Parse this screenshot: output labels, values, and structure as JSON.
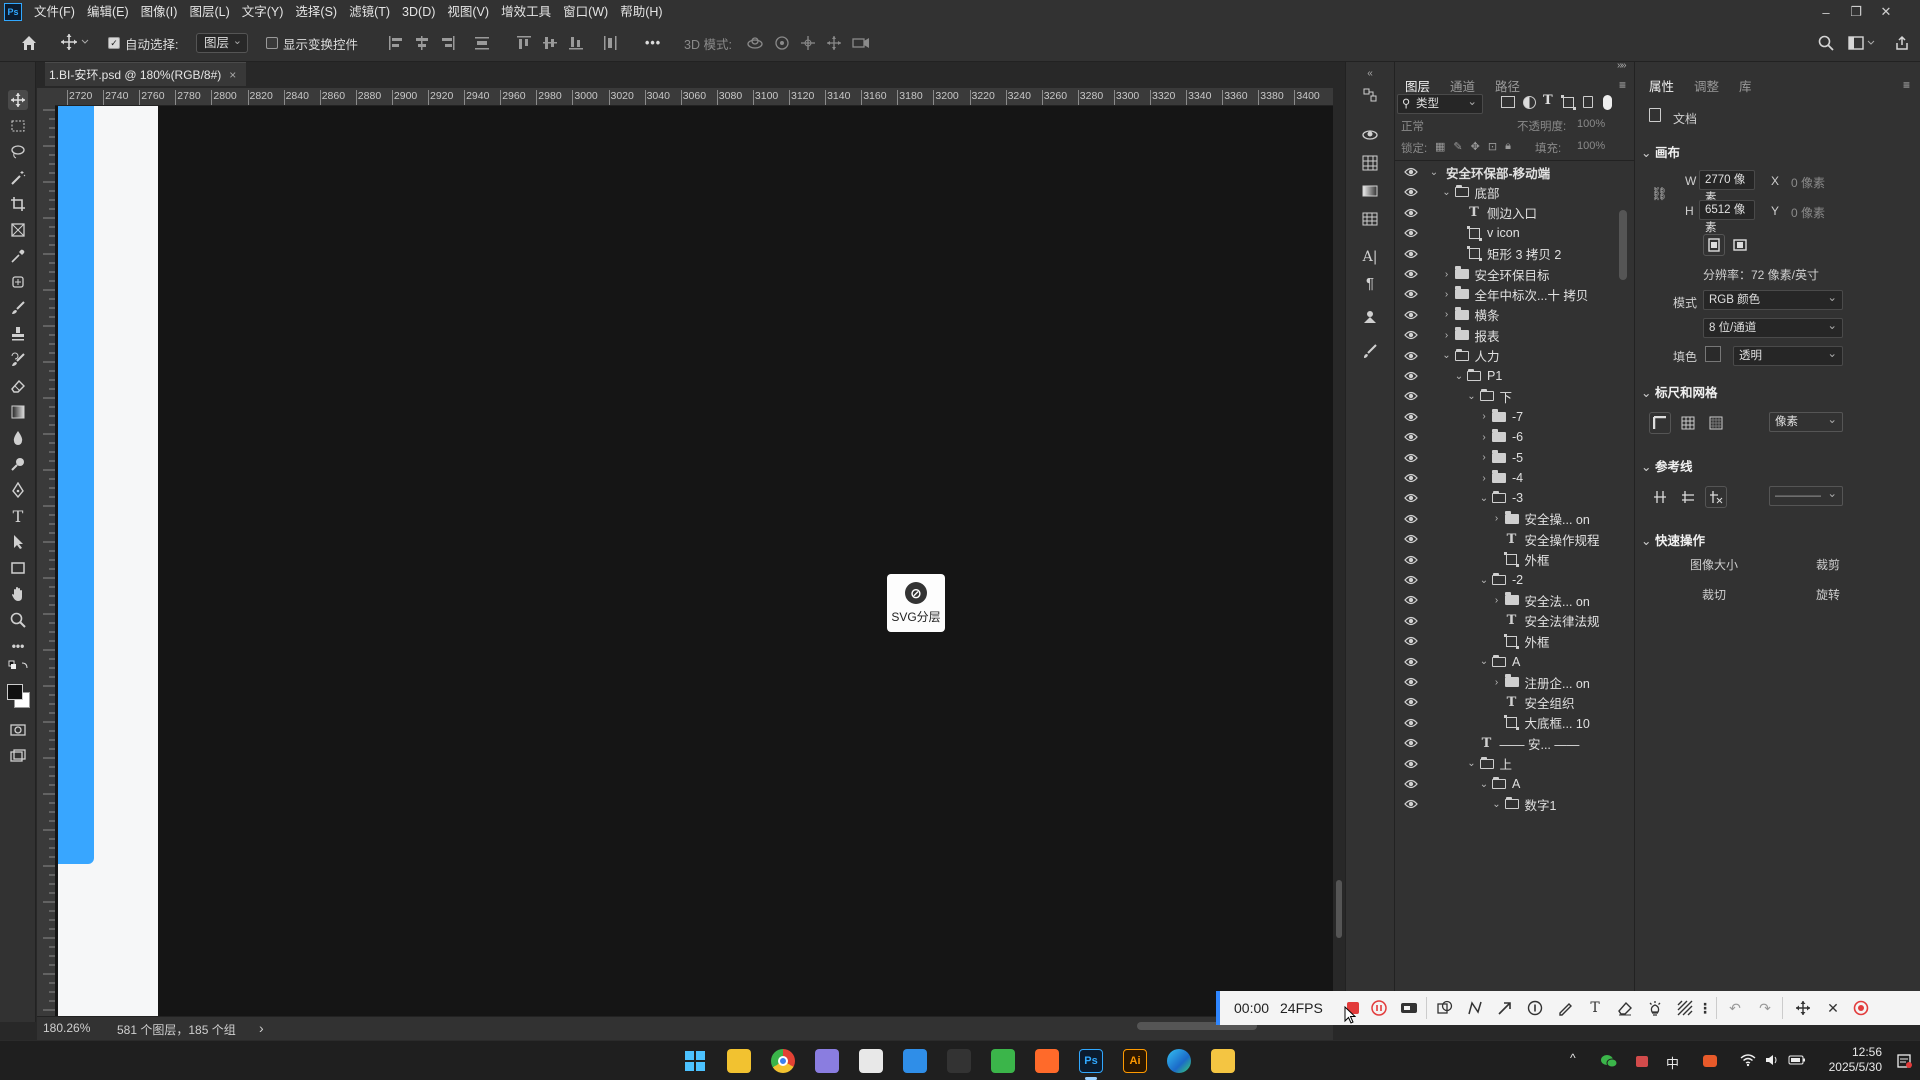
{
  "menubar": {
    "logo": "Ps",
    "items": [
      "文件(F)",
      "编辑(E)",
      "图像(I)",
      "图层(L)",
      "文字(Y)",
      "选择(S)",
      "滤镜(T)",
      "3D(D)",
      "视图(V)",
      "增效工具",
      "窗口(W)",
      "帮助(H)"
    ]
  },
  "options": {
    "auto_select_label": "自动选择:",
    "auto_select_value": "图层",
    "show_transform_label": "显示变换控件",
    "mode3d_label": "3D 模式:",
    "more": "•••"
  },
  "document": {
    "tab_title": "1.BI-安环.psd @ 180%(RGB/8#)",
    "tab_close": "×"
  },
  "ruler": {
    "h_ticks": [
      "2720",
      "2740",
      "2760",
      "2780",
      "2800",
      "2820",
      "2840",
      "2860",
      "2880",
      "2900",
      "2920",
      "2940",
      "2960",
      "2980",
      "3000",
      "3020",
      "3040",
      "3060",
      "3080",
      "3100",
      "3120",
      "3140",
      "3160",
      "3180",
      "3200",
      "3220",
      "3240",
      "3260",
      "3280",
      "3300",
      "3320",
      "3340",
      "3360",
      "3380",
      "3400"
    ]
  },
  "canvas": {
    "badge_label": "SVG分层"
  },
  "status": {
    "zoom": "180.26%",
    "info": "581 个图层，185 个组",
    "arrow": "›"
  },
  "layers_panel": {
    "tabs": [
      "图层",
      "通道",
      "路径"
    ],
    "filter_label": "类型",
    "blend_mode": "正常",
    "opacity_label": "不透明度:",
    "opacity_value": "100%",
    "lock_label": "锁定:",
    "fill_label": "填充:",
    "fill_value": "100%",
    "rows": [
      {
        "indent": 0,
        "arrow": "⌄",
        "icon": "none",
        "label": "安全环保部-移动端",
        "bold": true
      },
      {
        "indent": 1,
        "arrow": "⌄",
        "icon": "folder-open",
        "label": "底部"
      },
      {
        "indent": 2,
        "arrow": "",
        "icon": "text",
        "label": "侧边入口"
      },
      {
        "indent": 2,
        "arrow": "",
        "icon": "shape",
        "label": "v icon"
      },
      {
        "indent": 2,
        "arrow": "",
        "icon": "shape",
        "label": "矩形 3 拷贝 2"
      },
      {
        "indent": 1,
        "arrow": "›",
        "icon": "folder",
        "label": "安全环保目标"
      },
      {
        "indent": 1,
        "arrow": "›",
        "icon": "folder",
        "label": "全年中标次...十 拷贝"
      },
      {
        "indent": 1,
        "arrow": "›",
        "icon": "folder",
        "label": "横条"
      },
      {
        "indent": 1,
        "arrow": "›",
        "icon": "folder",
        "label": "报表"
      },
      {
        "indent": 1,
        "arrow": "⌄",
        "icon": "folder-open",
        "label": "人力"
      },
      {
        "indent": 2,
        "arrow": "⌄",
        "icon": "folder-open",
        "label": "P1"
      },
      {
        "indent": 3,
        "arrow": "⌄",
        "icon": "folder-open",
        "label": "下"
      },
      {
        "indent": 4,
        "arrow": "›",
        "icon": "folder",
        "label": "-7"
      },
      {
        "indent": 4,
        "arrow": "›",
        "icon": "folder",
        "label": "-6"
      },
      {
        "indent": 4,
        "arrow": "›",
        "icon": "folder",
        "label": "-5"
      },
      {
        "indent": 4,
        "arrow": "›",
        "icon": "folder",
        "label": "-4"
      },
      {
        "indent": 4,
        "arrow": "⌄",
        "icon": "folder-open",
        "label": "-3"
      },
      {
        "indent": 5,
        "arrow": "›",
        "icon": "folder",
        "label": "安全操... on"
      },
      {
        "indent": 5,
        "arrow": "",
        "icon": "text",
        "label": "安全操作规程"
      },
      {
        "indent": 5,
        "arrow": "",
        "icon": "shape",
        "label": "外框"
      },
      {
        "indent": 4,
        "arrow": "⌄",
        "icon": "folder-open",
        "label": "-2"
      },
      {
        "indent": 5,
        "arrow": "›",
        "icon": "folder",
        "label": "安全法... on"
      },
      {
        "indent": 5,
        "arrow": "",
        "icon": "text",
        "label": "安全法律法规"
      },
      {
        "indent": 5,
        "arrow": "",
        "icon": "shape",
        "label": "外框"
      },
      {
        "indent": 4,
        "arrow": "⌄",
        "icon": "folder-open",
        "label": "A"
      },
      {
        "indent": 5,
        "arrow": "›",
        "icon": "folder",
        "label": "注册企... on"
      },
      {
        "indent": 5,
        "arrow": "",
        "icon": "text",
        "label": "安全组织"
      },
      {
        "indent": 5,
        "arrow": "",
        "icon": "shape",
        "label": "大底框... 10"
      },
      {
        "indent": 3,
        "arrow": "",
        "icon": "text",
        "label": "—— 安... ——"
      },
      {
        "indent": 3,
        "arrow": "⌄",
        "icon": "folder-open",
        "label": "上"
      },
      {
        "indent": 4,
        "arrow": "⌄",
        "icon": "folder-open",
        "label": "A"
      },
      {
        "indent": 5,
        "arrow": "⌄",
        "icon": "folder-open",
        "label": "数字1"
      }
    ]
  },
  "properties_panel": {
    "tabs": [
      "属性",
      "调整",
      "库"
    ],
    "doc_label": "文档",
    "canvas_section": "画布",
    "w_label": "W",
    "w_value": "2770 像素",
    "h_label": "H",
    "h_value": "6512 像素",
    "x_label": "X",
    "x_value": "0 像素",
    "y_label": "Y",
    "y_value": "0 像素",
    "resolution": "分辨率：72 像素/英寸",
    "mode_label": "模式",
    "mode_value": "RGB 颜色",
    "depth_value": "8 位/通道",
    "fill_label": "填色",
    "fill_value": "透明",
    "rulers_section": "标尺和网格",
    "ruler_unit": "像素",
    "guides_section": "参考线",
    "guides_line": "————",
    "quick_section": "快速操作",
    "quick_buttons": [
      "图像大小",
      "裁剪",
      "裁切",
      "旋转"
    ]
  },
  "recorder": {
    "time": "00:00",
    "fps": "24FPS"
  },
  "taskbar": {
    "apps": [
      {
        "name": "start",
        "text": "",
        "color": "#3aa0ff"
      },
      {
        "name": "explorer",
        "text": "",
        "color": "#f2c230"
      },
      {
        "name": "chrome",
        "text": "",
        "color": "#e34234"
      },
      {
        "name": "photos",
        "text": "",
        "color": "#8a7de0"
      },
      {
        "name": "notes",
        "text": "",
        "color": "#e8e8e8"
      },
      {
        "name": "vscode",
        "text": "",
        "color": "#2f8ee8"
      },
      {
        "name": "capcut",
        "text": "",
        "color": "#333333"
      },
      {
        "name": "app-green",
        "text": "",
        "color": "#3bb54a"
      },
      {
        "name": "app-orange",
        "text": "",
        "color": "#ff6a2a"
      },
      {
        "name": "photoshop",
        "text": "Ps",
        "color": "#0b1b2e"
      },
      {
        "name": "illustrator",
        "text": "Ai",
        "color": "#2b1700"
      },
      {
        "name": "edge",
        "text": "",
        "color": "#1a9bd7"
      },
      {
        "name": "app-yellow",
        "text": "",
        "color": "#f4c542"
      }
    ],
    "ime": "中",
    "time": "12:56",
    "date": "2025/5/30"
  }
}
